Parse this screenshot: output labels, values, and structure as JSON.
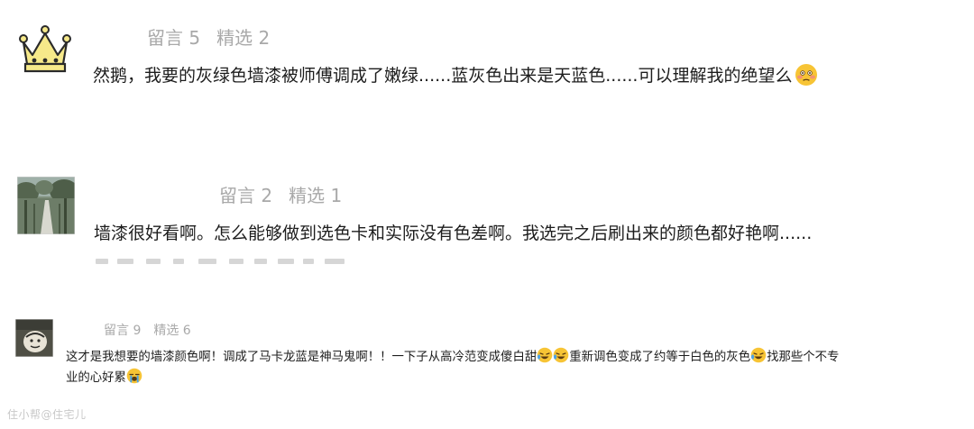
{
  "comments": [
    {
      "avatar_icon": "crown-icon",
      "stats": {
        "messages": "留言 5",
        "featured": "精选 2"
      },
      "text_parts": [
        "然鹅，我要的灰绿色墙漆被师傅调成了嫩绿......蓝灰色出来是天蓝色......可以理解我的绝望么"
      ],
      "emoji_icons": [
        "flushed-face-emoji"
      ]
    },
    {
      "avatar_icon": "forest-road-photo",
      "stats": {
        "messages": "留言 2",
        "featured": "精选 1"
      },
      "text_parts": [
        "墙漆很好看啊。怎么能够做到选色卡和实际没有色差啊。我选完之后刷出来的颜色都好艳啊......"
      ],
      "emoji_icons": []
    },
    {
      "avatar_icon": "cartoon-face-photo",
      "stats": {
        "messages": "留言 9",
        "featured": "精选 6"
      },
      "text_parts": [
        "这才是我想要的墙漆颜色啊！调成了马卡龙蓝是神马鬼啊！！一下子从高冷范变成傻白甜",
        "重新调色变成了约等于白色的灰色",
        "找那些个不专",
        "业的心好累"
      ],
      "emoji_icons": [
        "laughing-crying-emoji",
        "laughing-crying-emoji",
        "laughing-crying-emoji",
        "loudly-crying-emoji"
      ]
    }
  ],
  "watermark": "住小帮@住宅儿",
  "colors": {
    "meta_text": "#a9a9a9",
    "body_text": "#1d1d1d",
    "crown_gold": "#f6e98a",
    "emoji_yellow": "#f7c435"
  }
}
